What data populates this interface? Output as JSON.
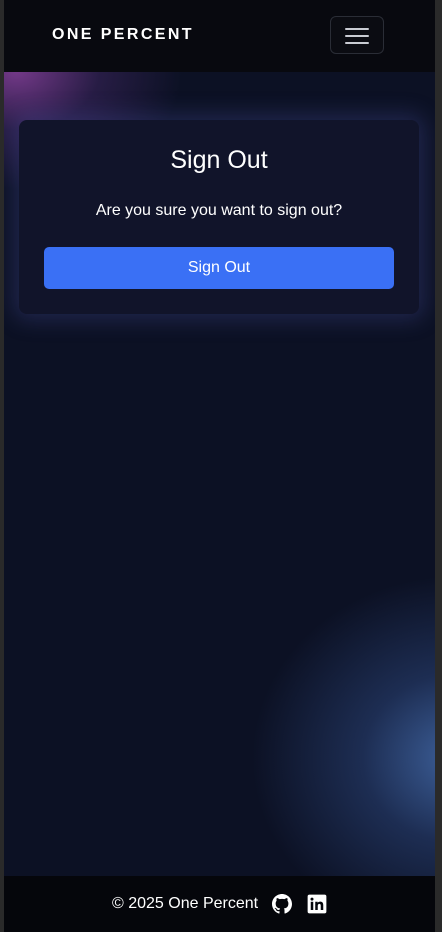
{
  "navbar": {
    "brand": "ONE PERCENT",
    "toggle_icon": "hamburger-menu-icon"
  },
  "card": {
    "title": "Sign Out",
    "message": "Are you sure you want to sign out?",
    "button_label": "Sign Out"
  },
  "footer": {
    "copyright": "© 2025 One Percent",
    "icons": [
      "github-icon",
      "linkedin-icon"
    ]
  },
  "colors": {
    "background": "#0c1124",
    "navbar": "#08090f",
    "card": "#11142a",
    "primary_button": "#3a70f5",
    "text": "#ffffff"
  }
}
